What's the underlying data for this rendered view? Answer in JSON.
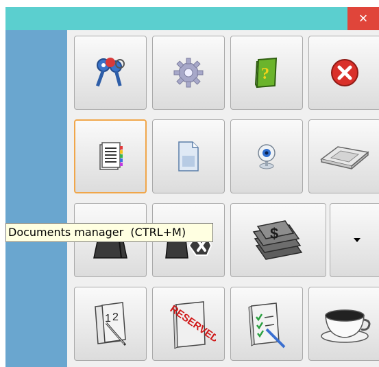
{
  "window": {
    "close_glyph": "×",
    "title_color": "#5bcfcf",
    "close_color": "#e0453a",
    "side_color": "#6aa6cf"
  },
  "toolbar": {
    "rows": [
      [
        "keys-icon",
        "gear-icon",
        "help-book-icon",
        "exit-icon"
      ],
      [
        "documents-manager-icon",
        "document-icon",
        "webcam-icon",
        "card-reader-icon"
      ],
      [
        "cash-drawer-icon",
        "cancel-drawer-icon",
        "money-icon",
        "dropdown-arrow-icon"
      ],
      [
        "calendar-icon",
        "reserved-icon",
        "checklist-icon",
        "coffee-cup-icon"
      ]
    ],
    "selected": "documents-manager-icon"
  },
  "tooltip": {
    "text": "Documents manager  (CTRL+M)"
  }
}
